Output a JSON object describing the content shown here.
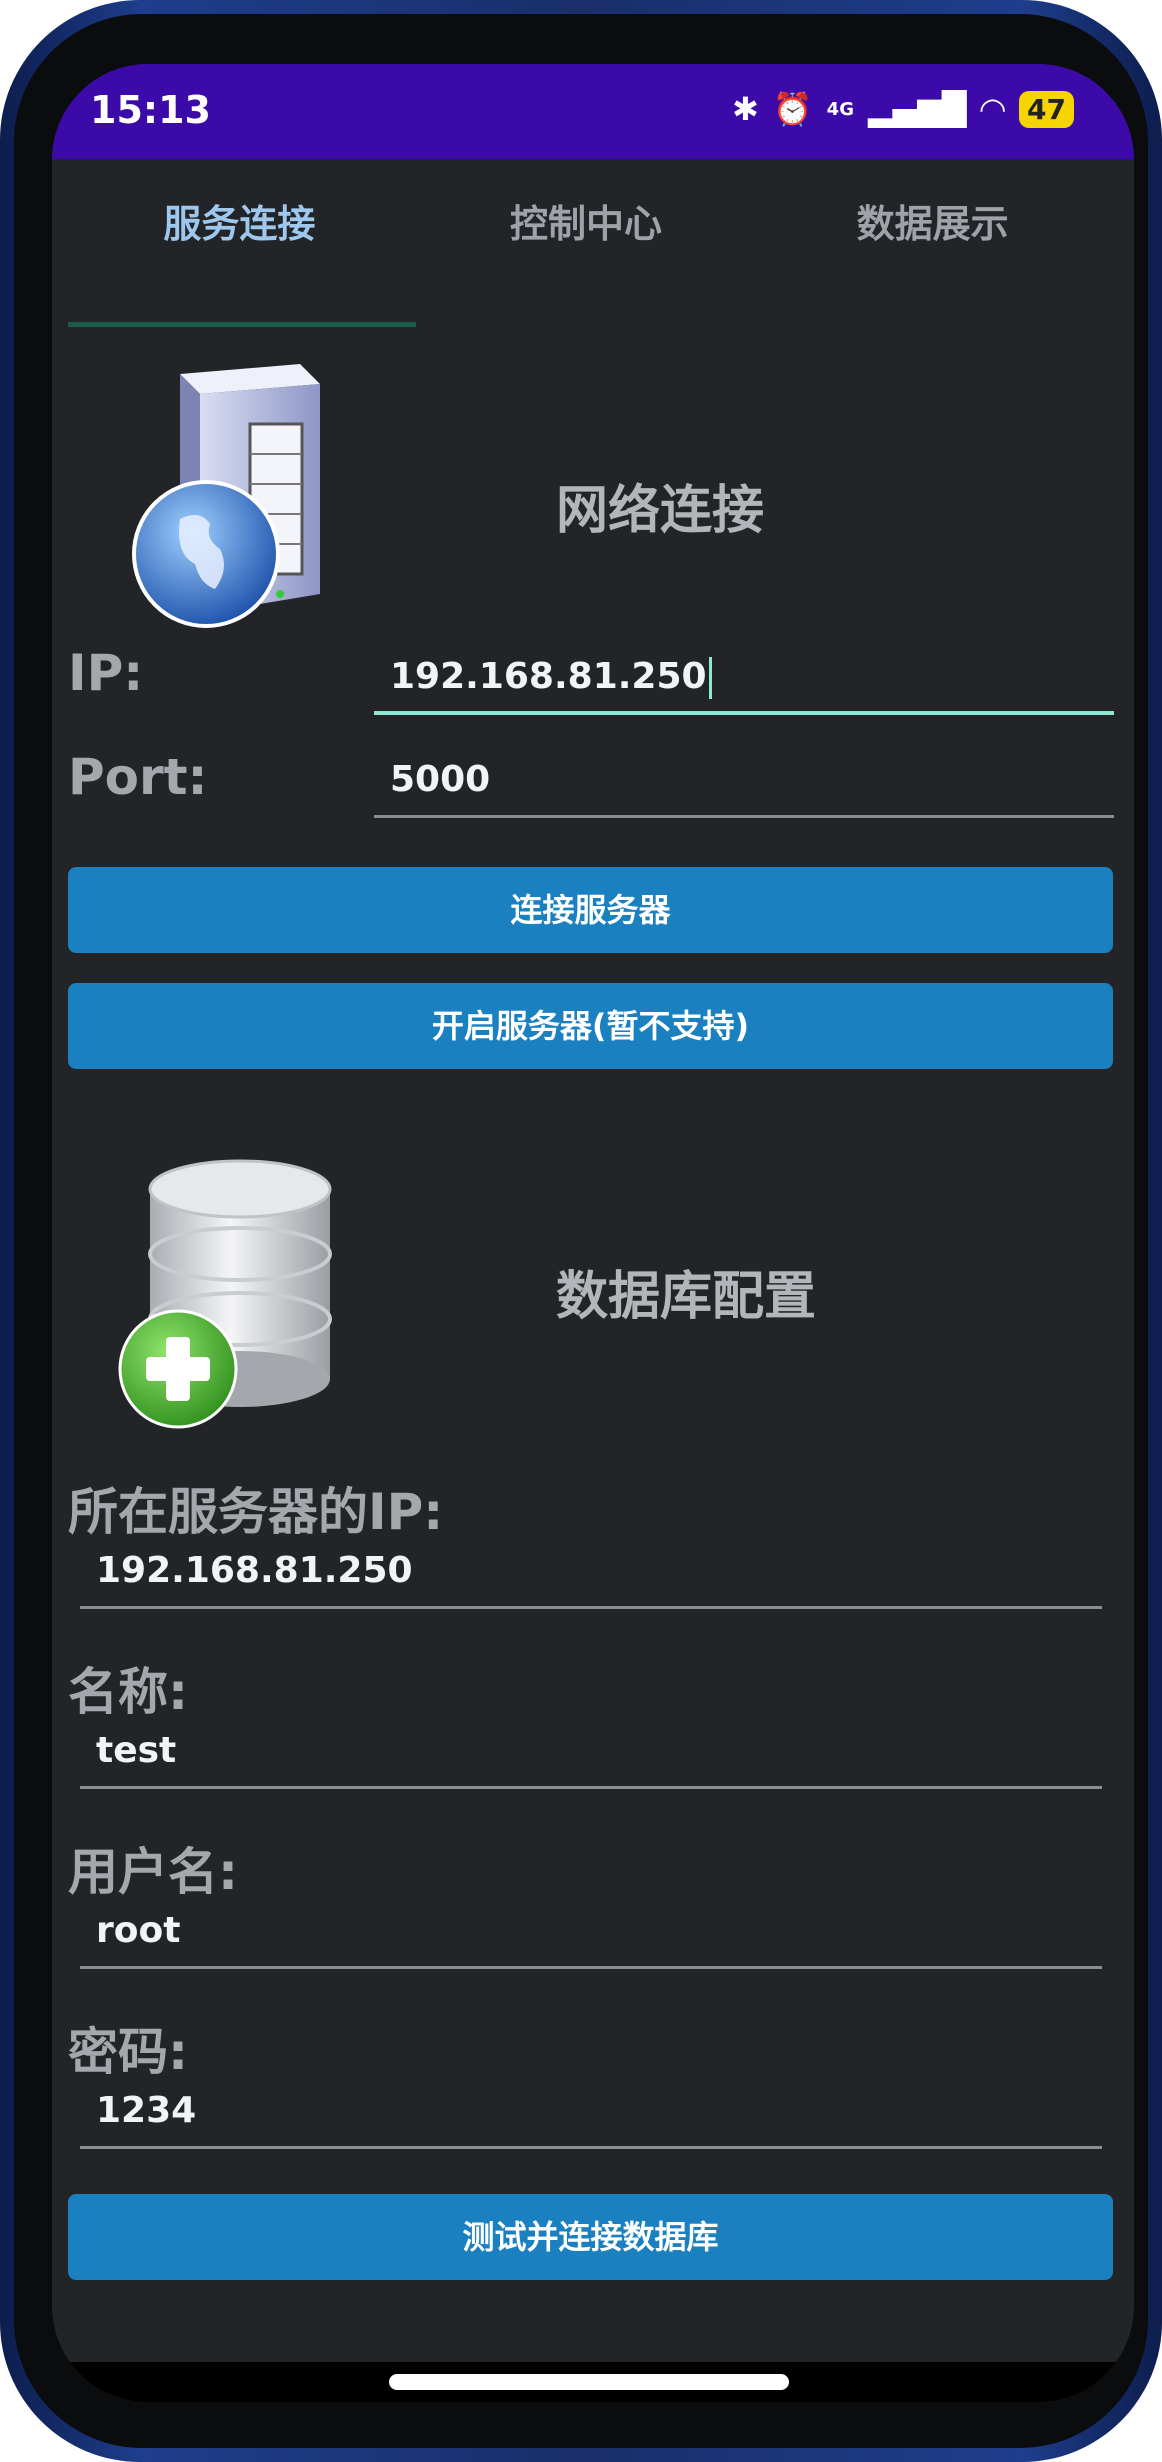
{
  "status_bar": {
    "time": "15:13",
    "network": "4G",
    "battery": "47"
  },
  "tabs": [
    {
      "label": "服务连接"
    },
    {
      "label": "控制中心"
    },
    {
      "label": "数据展示"
    }
  ],
  "network_section": {
    "title": "网络连接",
    "ip_label": "IP:",
    "ip_value": "192.168.81.250",
    "port_label": "Port:",
    "port_value": "5000",
    "connect_button": "连接服务器",
    "start_server_button": "开启服务器(暂不支持)"
  },
  "database_section": {
    "title": "数据库配置",
    "server_ip_label": "所在服务器的IP:",
    "server_ip_value": "192.168.81.250",
    "name_label": "名称:",
    "name_value": "test",
    "username_label": "用户名:",
    "username_value": "root",
    "password_label": "密码:",
    "password_value": "1234",
    "test_connect_button": "测试并连接数据库"
  }
}
